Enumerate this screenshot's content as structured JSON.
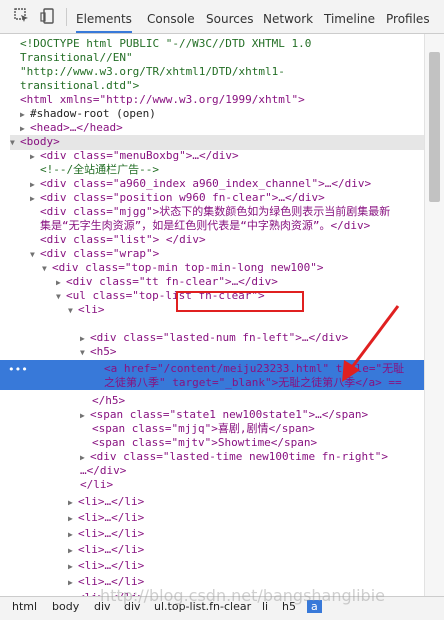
{
  "toolbar": {
    "tabs": [
      {
        "label": "Elements",
        "active": true
      },
      {
        "label": "Console"
      },
      {
        "label": "Sources"
      },
      {
        "label": "Network"
      },
      {
        "label": "Timeline"
      },
      {
        "label": "Profiles"
      }
    ],
    "icons": [
      "inspect-icon",
      "device-icon"
    ]
  },
  "dom": {
    "doctype1": "<!DOCTYPE html PUBLIC \"-//W3C//DTD XHTML 1.0",
    "doctype2": "Transitional//EN\"",
    "doctype3": "\"http://www.w3.org/TR/xhtml1/DTD/xhtml1-",
    "doctype4": "transitional.dtd\">",
    "html_open": "<html xmlns=\"http://www.w3.org/1999/xhtml\">",
    "shadow_root": "#shadow-root (open)",
    "head": "<head>…</head>",
    "body_open": "<body>",
    "menu_div": "<div class=\"menuBoxbg\">…</div>",
    "comment": "<!--/全站通栏广告-->",
    "a960_div": "<div class=\"a960_index a960_index_channel\">…</div>",
    "position_div": "<div class=\"position w960 fn-clear\">…</div>",
    "mjgg_line1": "<div class=\"mjgg\">状态下的集数颜色如为绿色则表示当前剧集最新",
    "mjgg_line2": "集是“无字生肉资源”，如是红色则代表是“中字熟肉资源”。</div>",
    "list_div": "<div class=\"list\"> </div>",
    "wrap_div": "<div class=\"wrap\">",
    "topmin_div": "<div class=\"top-min top-min-long new100\">",
    "tt_div": "<div class=\"tt fn-clear\">…</div>",
    "ul_toplist": "<ul class=\"top-list  fn-clear\">",
    "li_open": "<li>",
    "lasted_num": "<div class=\"lasted-num fn-left\">…</div>",
    "h5_open": "<h5>",
    "sel_line1": "<a href=\"/content/meiju23233.html\" title=\"无耻",
    "sel_line2": "之徒第八季\" target=\"_blank\">无耻之徒第八季</a> ==",
    "h5_close": "</h5>",
    "state1": "<span class=\"state1 new100state1\">…</span>",
    "mjjq": "<span class=\"mjjq\">喜剧,剧情</span>",
    "mjtv": "<span class=\"mjtv\">Showtime</span>",
    "lasted_time": "<div class=\"lasted-time new100time fn-right\">",
    "div_close_partial": "…</div>",
    "li_close": "</li>",
    "li_collapsed": "<li>…</li>"
  },
  "breadcrumbs": [
    "html",
    "body",
    "div",
    "div",
    "ul.top-list.fn-clear",
    "li",
    "h5",
    "a"
  ],
  "watermark": "http://blog.csdn.net/bangshanglibie",
  "colors": {
    "selection": "#3879d9",
    "highlight_box": "#e02020",
    "arrow": "#e02020"
  }
}
